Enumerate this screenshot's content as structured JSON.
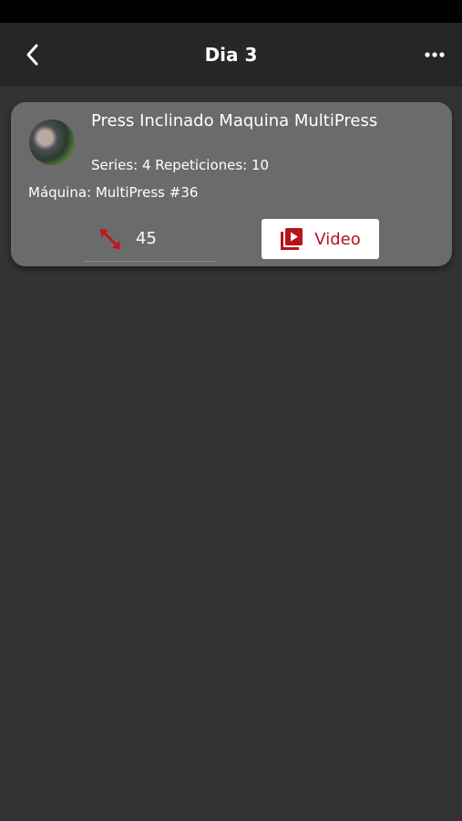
{
  "header": {
    "title": "Dia 3",
    "back_icon": "chevron-left-icon",
    "more_icon": "ellipsis-icon"
  },
  "exercise": {
    "name": "Press Inclinado Maquina MultiPress",
    "meta": "Series: 4 Repeticiones: 10",
    "machine": "Máquina: MultiPress #36",
    "weight": "45",
    "weight_icon": "resize-arrows-icon",
    "video_label": "Video",
    "video_icon": "video-library-icon"
  },
  "colors": {
    "background": "#333333",
    "header": "#262626",
    "card": "#6b6b6b",
    "accent": "#b7141c"
  }
}
